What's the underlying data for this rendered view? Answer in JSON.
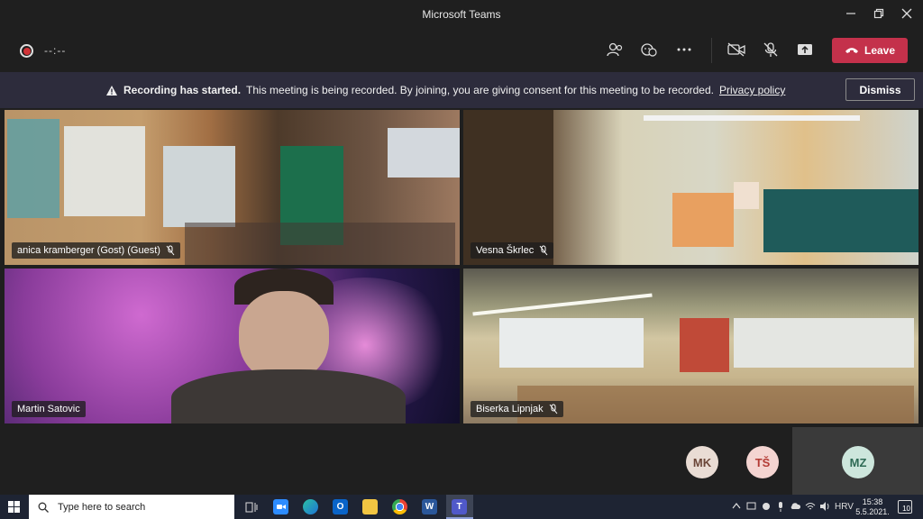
{
  "window": {
    "title": "Microsoft Teams"
  },
  "toolbar": {
    "timer": "--:--",
    "leave_label": "Leave"
  },
  "banner": {
    "bold_text": "Recording has started.",
    "message": "This meeting is being recorded. By joining, you are giving consent for this meeting to be recorded.",
    "link": "Privacy policy",
    "dismiss_label": "Dismiss"
  },
  "participants": {
    "tile1_name": "anica kramberger (Gost) (Guest)",
    "tile2_name": "Vesna Škrlec",
    "tile3_name": "Martin Satovic",
    "tile4_name": "Biserka Lipnjak"
  },
  "avatars": {
    "mk": "MK",
    "ts": "TŠ",
    "mz": "MZ"
  },
  "colors": {
    "leave_red": "#c4314b",
    "banner_bg": "#2d2c3c",
    "app_bg": "#1f1f1f",
    "taskbar_bg": "#1e2433"
  },
  "taskbar": {
    "search_placeholder": "Type here to search",
    "language": "HRV",
    "time": "15:38",
    "date": "5.5.2021.",
    "notification_count": "10"
  }
}
